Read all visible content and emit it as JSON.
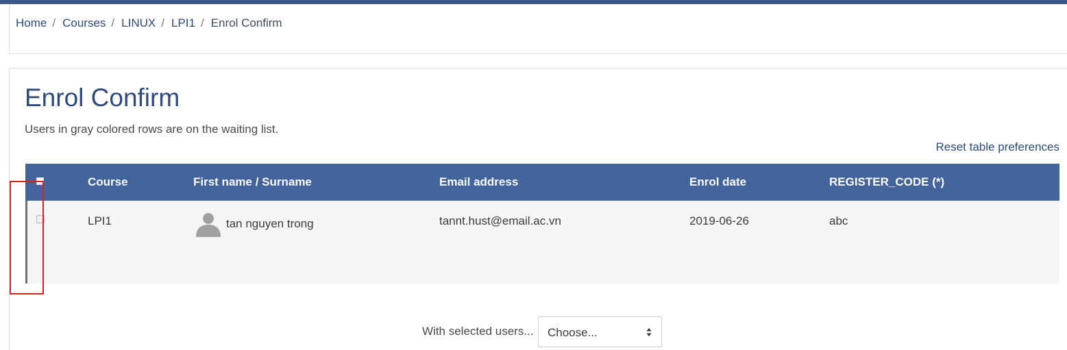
{
  "breadcrumb": {
    "items": [
      "Home",
      "Courses",
      "LINUX",
      "LPI1"
    ],
    "separator": "/",
    "current": "Enrol Confirm"
  },
  "page": {
    "title": "Enrol Confirm",
    "notice": "Users in gray colored rows are on the waiting list.",
    "reset_label": "Reset table preferences"
  },
  "table": {
    "columns": [
      "Course",
      "First name / Surname",
      "Email address",
      "Enrol date",
      "REGISTER_CODE (*)"
    ],
    "rows": [
      {
        "course": "LPI1",
        "name": "tan nguyen trong",
        "email": "tannt.hust@email.ac.vn",
        "enrol_date": "2019-06-26",
        "register_code": "abc",
        "waiting": true
      }
    ]
  },
  "bulk": {
    "label": "With selected users...",
    "select_value": "Choose..."
  },
  "colors": {
    "accent": "#43639d",
    "header_bar": "#3e5588",
    "highlight": "#e02020"
  },
  "icons": [
    "user-avatar-icon",
    "select-arrows-icon"
  ]
}
